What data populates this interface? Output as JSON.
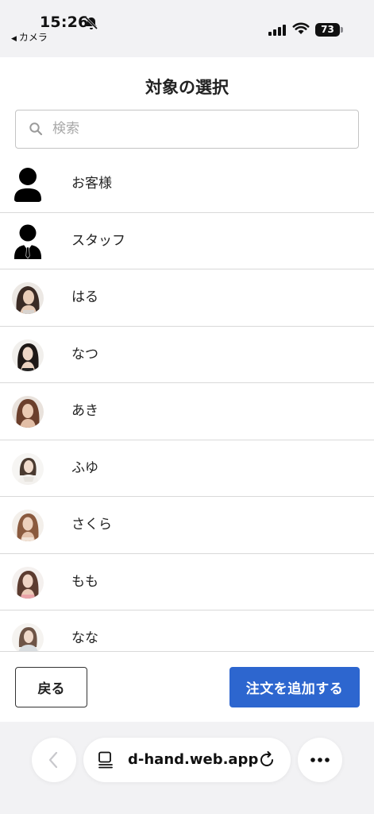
{
  "status_bar": {
    "time": "15:26",
    "back_app": "カメラ",
    "battery": "73"
  },
  "page": {
    "title": "対象の選択",
    "search_placeholder": "検索"
  },
  "list": [
    {
      "label": "お客様",
      "icon": "person-icon"
    },
    {
      "label": "スタッフ",
      "icon": "staff-icon"
    },
    {
      "label": "はる",
      "icon": "avatar-photo"
    },
    {
      "label": "なつ",
      "icon": "avatar-photo"
    },
    {
      "label": "あき",
      "icon": "avatar-photo"
    },
    {
      "label": "ふゆ",
      "icon": "avatar-photo"
    },
    {
      "label": "さくら",
      "icon": "avatar-photo"
    },
    {
      "label": "もも",
      "icon": "avatar-photo"
    },
    {
      "label": "なな",
      "icon": "avatar-photo"
    }
  ],
  "footer": {
    "back_label": "戻る",
    "add_label": "注文を追加する",
    "accent_color": "#2d66cf"
  },
  "browser": {
    "url": "d-hand.web.app"
  }
}
